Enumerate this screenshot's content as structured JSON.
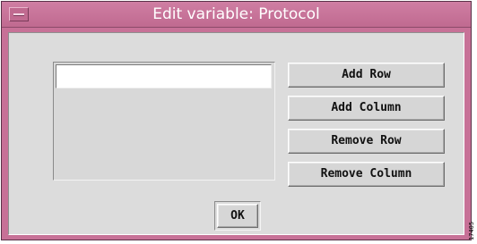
{
  "window": {
    "title": "Edit variable: Protocol"
  },
  "editor": {
    "entry_value": ""
  },
  "buttons": {
    "add_row": "Add Row",
    "add_column": "Add Column",
    "remove_row": "Remove Row",
    "remove_column": "Remove Column",
    "ok": "OK"
  },
  "figure_id": "17405",
  "colors": {
    "titlebar": "#c77197",
    "client_background": "#dcdcdc",
    "button_face": "#d6d6d6"
  },
  "icons": {
    "window_menu": "window-menu-icon"
  }
}
